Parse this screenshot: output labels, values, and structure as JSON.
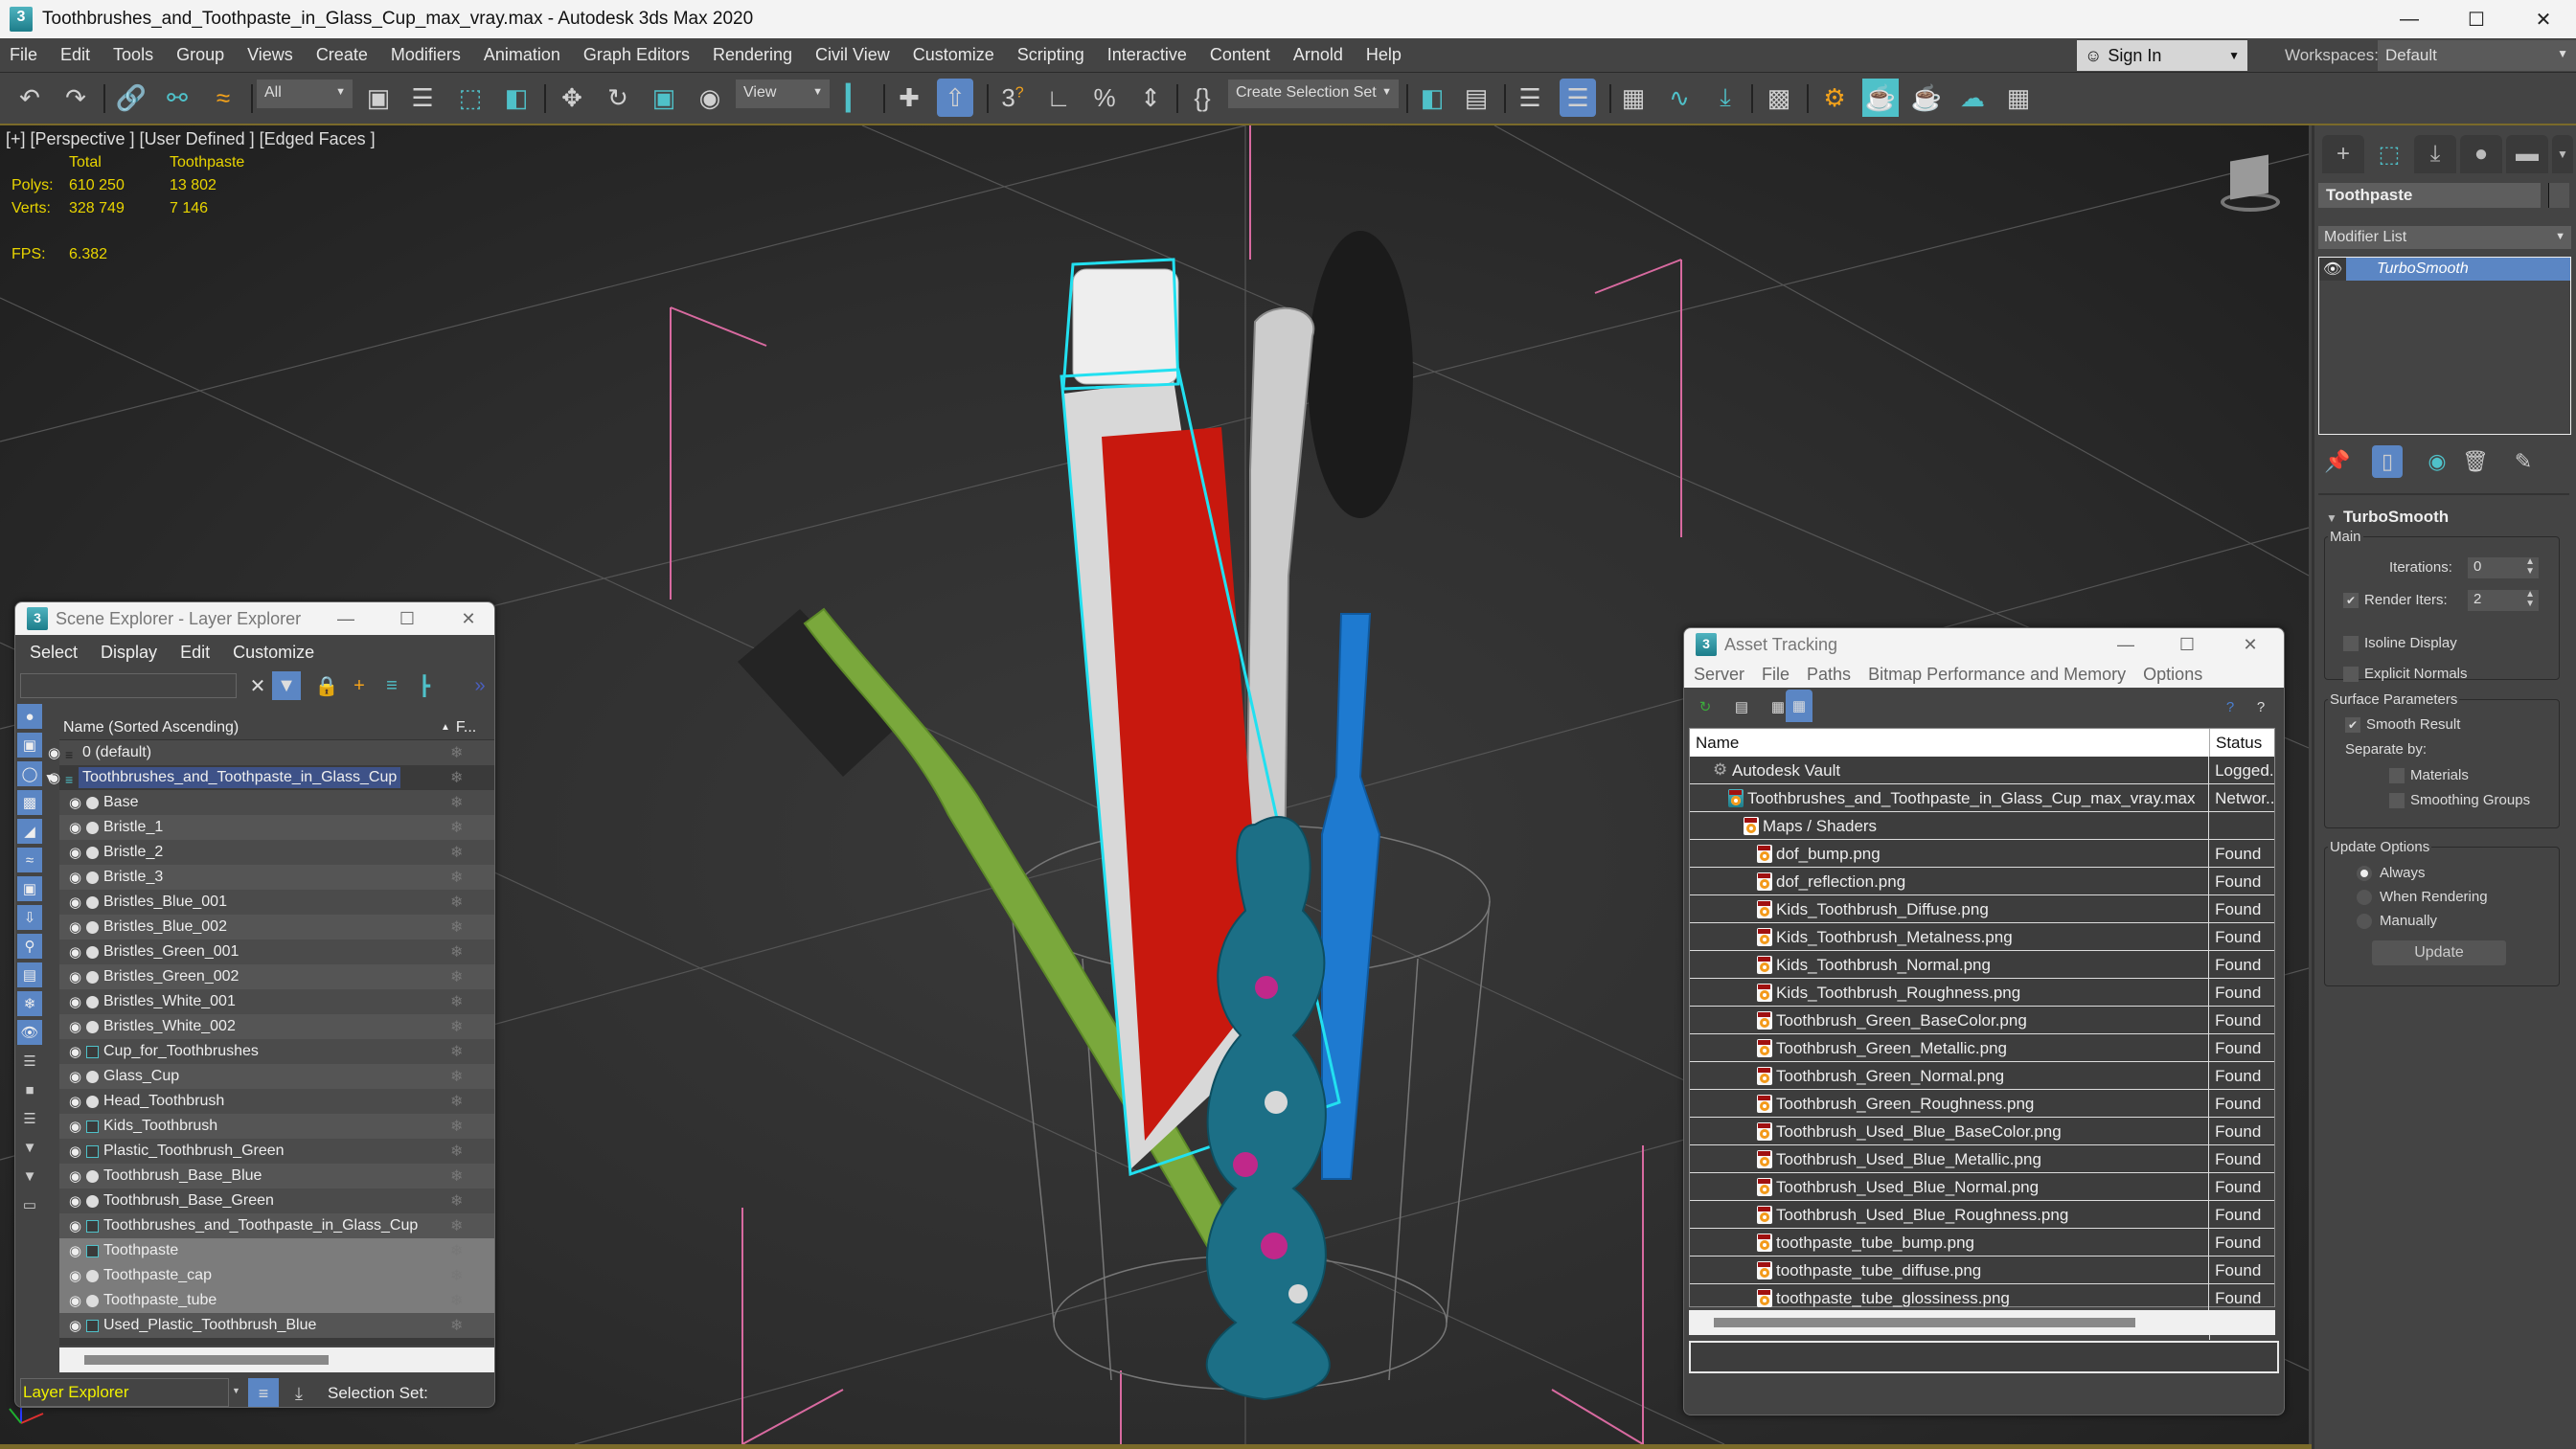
{
  "window": {
    "title": "Toothbrushes_and_Toothpaste_in_Glass_Cup_max_vray.max - Autodesk 3ds Max 2020",
    "app_icon": "3",
    "controls": [
      "minimize-icon",
      "maximize-icon",
      "close-icon"
    ]
  },
  "menubar": {
    "items": [
      "File",
      "Edit",
      "Tools",
      "Group",
      "Views",
      "Create",
      "Modifiers",
      "Animation",
      "Graph Editors",
      "Rendering",
      "Civil View",
      "Customize",
      "Scripting",
      "Interactive",
      "Content",
      "Arnold",
      "Help"
    ],
    "sign_in": "Sign In",
    "workspaces_label": "Workspaces:",
    "workspace_value": "Default"
  },
  "toolbar": {
    "selection_filter": "All",
    "ref_coord": "View",
    "selection_set_placeholder": "Create Selection Set",
    "icons": [
      "undo-icon",
      "redo-icon",
      "link-icon",
      "unlink-icon",
      "bind-space-warp-icon",
      "select-object-icon",
      "select-by-name-icon",
      "rectangular-selection-icon",
      "window-crossing-icon",
      "move-icon",
      "rotate-icon",
      "scale-icon",
      "place-icon",
      "use-pivot-icon",
      "select-manipulate-icon",
      "snaps-toggle-icon",
      "angle-snap-icon",
      "percent-snap-icon",
      "spinner-snap-icon",
      "named-selection-edit-icon",
      "mirror-icon",
      "align-icon",
      "scene-explorer-toggle-icon",
      "layer-explorer-icon",
      "toggle-ribbon-icon",
      "curve-editor-icon",
      "schematic-view-icon",
      "material-editor-icon",
      "render-setup-icon",
      "rendered-frame-window-icon",
      "render-production-icon",
      "render-cloud-icon",
      "viewport-layouts-icon"
    ]
  },
  "viewport": {
    "label": "[+] [Perspective ] [User Defined ] [Edged Faces ]",
    "stats": {
      "col_total": "Total",
      "col_selected": "Toothpaste",
      "polys_label": "Polys:",
      "polys_total": "610 250",
      "polys_selected": "13 802",
      "verts_label": "Verts:",
      "verts_total": "328 749",
      "verts_selected": "7 146",
      "fps_label": "FPS:",
      "fps_value": "6.382"
    },
    "selection_color": "#22e0f0",
    "stats_color": "#e8d400"
  },
  "command_panel": {
    "tabs": [
      "create-icon",
      "modify-icon",
      "hierarchy-icon",
      "motion-icon",
      "display-icon",
      "utilities-icon"
    ],
    "object_name": "Toothpaste",
    "modifier_list_label": "Modifier List",
    "modifier_stack": [
      {
        "name": "TurboSmooth",
        "visible": true,
        "selected": true
      }
    ],
    "turbosmooth": {
      "title": "TurboSmooth",
      "main_label": "Main",
      "iterations_label": "Iterations:",
      "iterations_value": "0",
      "render_iters_label": "Render Iters:",
      "render_iters_checked": true,
      "render_iters_value": "2",
      "isoline_label": "Isoline Display",
      "isoline_checked": false,
      "explicit_normals_label": "Explicit Normals",
      "explicit_normals_checked": false,
      "surface_label": "Surface Parameters",
      "smooth_result_label": "Smooth Result",
      "smooth_result_checked": true,
      "separate_by_label": "Separate by:",
      "materials_label": "Materials",
      "materials_checked": false,
      "smoothing_groups_label": "Smoothing Groups",
      "smoothing_groups_checked": false,
      "update_options_label": "Update Options",
      "update_options": [
        "Always",
        "When Rendering",
        "Manually"
      ],
      "update_selected": "Always",
      "update_button": "Update"
    }
  },
  "scene_explorer": {
    "title": "Scene Explorer - Layer Explorer",
    "menu": [
      "Select",
      "Display",
      "Edit",
      "Customize"
    ],
    "search_value": "",
    "column_name": "Name (Sorted Ascending)",
    "column_freeze": "F...",
    "rows": [
      {
        "name": "0 (default)",
        "type": "layer",
        "level": 0,
        "state": "normal"
      },
      {
        "name": "Toothbrushes_and_Toothpaste_in_Glass_Cup",
        "type": "layer-active",
        "level": 0,
        "state": "highlight",
        "expanded": true
      },
      {
        "name": "Base",
        "type": "object",
        "level": 1,
        "state": "normal"
      },
      {
        "name": "Bristle_1",
        "type": "object",
        "level": 1,
        "state": "normal"
      },
      {
        "name": "Bristle_2",
        "type": "object",
        "level": 1,
        "state": "normal"
      },
      {
        "name": "Bristle_3",
        "type": "object",
        "level": 1,
        "state": "normal"
      },
      {
        "name": "Bristles_Blue_001",
        "type": "object",
        "level": 1,
        "state": "normal"
      },
      {
        "name": "Bristles_Blue_002",
        "type": "object",
        "level": 1,
        "state": "normal"
      },
      {
        "name": "Bristles_Green_001",
        "type": "object",
        "level": 1,
        "state": "normal"
      },
      {
        "name": "Bristles_Green_002",
        "type": "object",
        "level": 1,
        "state": "normal"
      },
      {
        "name": "Bristles_White_001",
        "type": "object",
        "level": 1,
        "state": "normal"
      },
      {
        "name": "Bristles_White_002",
        "type": "object",
        "level": 1,
        "state": "normal"
      },
      {
        "name": "Cup_for_Toothbrushes",
        "type": "group",
        "level": 1,
        "state": "normal"
      },
      {
        "name": "Glass_Cup",
        "type": "object",
        "level": 1,
        "state": "normal"
      },
      {
        "name": "Head_Toothbrush",
        "type": "object",
        "level": 1,
        "state": "normal"
      },
      {
        "name": "Kids_Toothbrush",
        "type": "group",
        "level": 1,
        "state": "normal"
      },
      {
        "name": "Plastic_Toothbrush_Green",
        "type": "group",
        "level": 1,
        "state": "normal"
      },
      {
        "name": "Toothbrush_Base_Blue",
        "type": "object",
        "level": 1,
        "state": "normal"
      },
      {
        "name": "Toothbrush_Base_Green",
        "type": "object",
        "level": 1,
        "state": "normal"
      },
      {
        "name": "Toothbrushes_and_Toothpaste_in_Glass_Cup",
        "type": "group",
        "level": 1,
        "state": "normal"
      },
      {
        "name": "Toothpaste",
        "type": "group",
        "level": 1,
        "state": "selected"
      },
      {
        "name": "Toothpaste_cap",
        "type": "object",
        "level": 1,
        "state": "selected"
      },
      {
        "name": "Toothpaste_tube",
        "type": "object",
        "level": 1,
        "state": "selected"
      },
      {
        "name": "Used_Plastic_Toothbrush_Blue",
        "type": "group",
        "level": 1,
        "state": "normal"
      }
    ],
    "explorer_type": "Layer Explorer",
    "selection_set_label": "Selection Set:"
  },
  "asset_tracking": {
    "title": "Asset Tracking",
    "menu": [
      "Server",
      "File",
      "Paths",
      "Bitmap Performance and Memory",
      "Options"
    ],
    "columns": [
      "Name",
      "Status"
    ],
    "rows": [
      {
        "name": "Autodesk Vault",
        "status": "Logged...",
        "level": 0,
        "icon": "vault-icon"
      },
      {
        "name": "Toothbrushes_and_Toothpaste_in_Glass_Cup_max_vray.max",
        "status": "Networ...",
        "level": 1,
        "icon": "max-file-icon"
      },
      {
        "name": "Maps / Shaders",
        "status": "",
        "level": 2,
        "icon": "maps-folder-icon"
      },
      {
        "name": "dof_bump.png",
        "status": "Found",
        "level": 3,
        "icon": "png-icon"
      },
      {
        "name": "dof_reflection.png",
        "status": "Found",
        "level": 3,
        "icon": "png-icon"
      },
      {
        "name": "Kids_Toothbrush_Diffuse.png",
        "status": "Found",
        "level": 3,
        "icon": "png-icon"
      },
      {
        "name": "Kids_Toothbrush_Metalness.png",
        "status": "Found",
        "level": 3,
        "icon": "png-icon"
      },
      {
        "name": "Kids_Toothbrush_Normal.png",
        "status": "Found",
        "level": 3,
        "icon": "png-icon"
      },
      {
        "name": "Kids_Toothbrush_Roughness.png",
        "status": "Found",
        "level": 3,
        "icon": "png-icon"
      },
      {
        "name": "Toothbrush_Green_BaseColor.png",
        "status": "Found",
        "level": 3,
        "icon": "png-icon"
      },
      {
        "name": "Toothbrush_Green_Metallic.png",
        "status": "Found",
        "level": 3,
        "icon": "png-icon"
      },
      {
        "name": "Toothbrush_Green_Normal.png",
        "status": "Found",
        "level": 3,
        "icon": "png-icon"
      },
      {
        "name": "Toothbrush_Green_Roughness.png",
        "status": "Found",
        "level": 3,
        "icon": "png-icon"
      },
      {
        "name": "Toothbrush_Used_Blue_BaseColor.png",
        "status": "Found",
        "level": 3,
        "icon": "png-icon"
      },
      {
        "name": "Toothbrush_Used_Blue_Metallic.png",
        "status": "Found",
        "level": 3,
        "icon": "png-icon"
      },
      {
        "name": "Toothbrush_Used_Blue_Normal.png",
        "status": "Found",
        "level": 3,
        "icon": "png-icon"
      },
      {
        "name": "Toothbrush_Used_Blue_Roughness.png",
        "status": "Found",
        "level": 3,
        "icon": "png-icon"
      },
      {
        "name": "toothpaste_tube_bump.png",
        "status": "Found",
        "level": 3,
        "icon": "png-icon"
      },
      {
        "name": "toothpaste_tube_diffuse.png",
        "status": "Found",
        "level": 3,
        "icon": "png-icon"
      },
      {
        "name": "toothpaste_tube_glossiness.png",
        "status": "Found",
        "level": 3,
        "icon": "png-icon"
      }
    ],
    "status_field": ""
  }
}
